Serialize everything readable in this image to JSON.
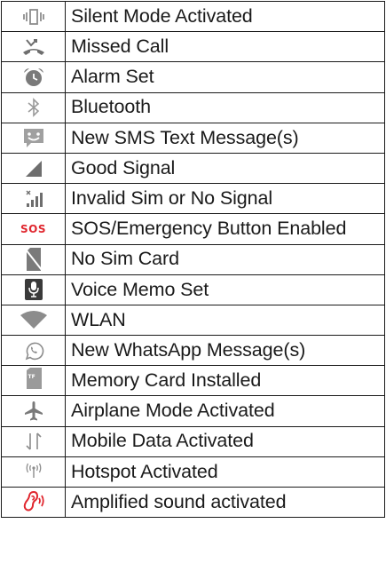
{
  "colors": {
    "icon_gray": "#8c8c8c",
    "icon_dark": "#6e6e6e",
    "accent_red": "#e0262e",
    "border": "#1a1a1a",
    "text": "#1a1a1a"
  },
  "rows": [
    {
      "icon": "vibrate-icon",
      "label": "Silent Mode Activated"
    },
    {
      "icon": "missed-call-icon",
      "label": "Missed Call"
    },
    {
      "icon": "alarm-icon",
      "label": "Alarm Set"
    },
    {
      "icon": "bluetooth-icon",
      "label": "Bluetooth"
    },
    {
      "icon": "sms-icon",
      "label": "New SMS Text Message(s)"
    },
    {
      "icon": "signal-icon",
      "label": "Good Signal"
    },
    {
      "icon": "no-signal-icon",
      "label": "Invalid Sim or No Signal"
    },
    {
      "icon": "sos-icon",
      "icon_text": "SOS",
      "label": "SOS/Emergency Button Enabled"
    },
    {
      "icon": "no-sim-icon",
      "label": "No Sim Card"
    },
    {
      "icon": "voice-memo-icon",
      "label": "Voice Memo Set"
    },
    {
      "icon": "wlan-icon",
      "label": "WLAN"
    },
    {
      "icon": "whatsapp-icon",
      "label": "New WhatsApp Message(s)"
    },
    {
      "icon": "memory-card-icon",
      "icon_text": "TF",
      "label": "Memory Card Installed"
    },
    {
      "icon": "airplane-icon",
      "label": "Airplane Mode Activated"
    },
    {
      "icon": "mobile-data-icon",
      "label": "Mobile Data Activated"
    },
    {
      "icon": "hotspot-icon",
      "label": "Hotspot Activated"
    },
    {
      "icon": "amplified-sound-icon",
      "label": "Amplified sound activated"
    }
  ]
}
